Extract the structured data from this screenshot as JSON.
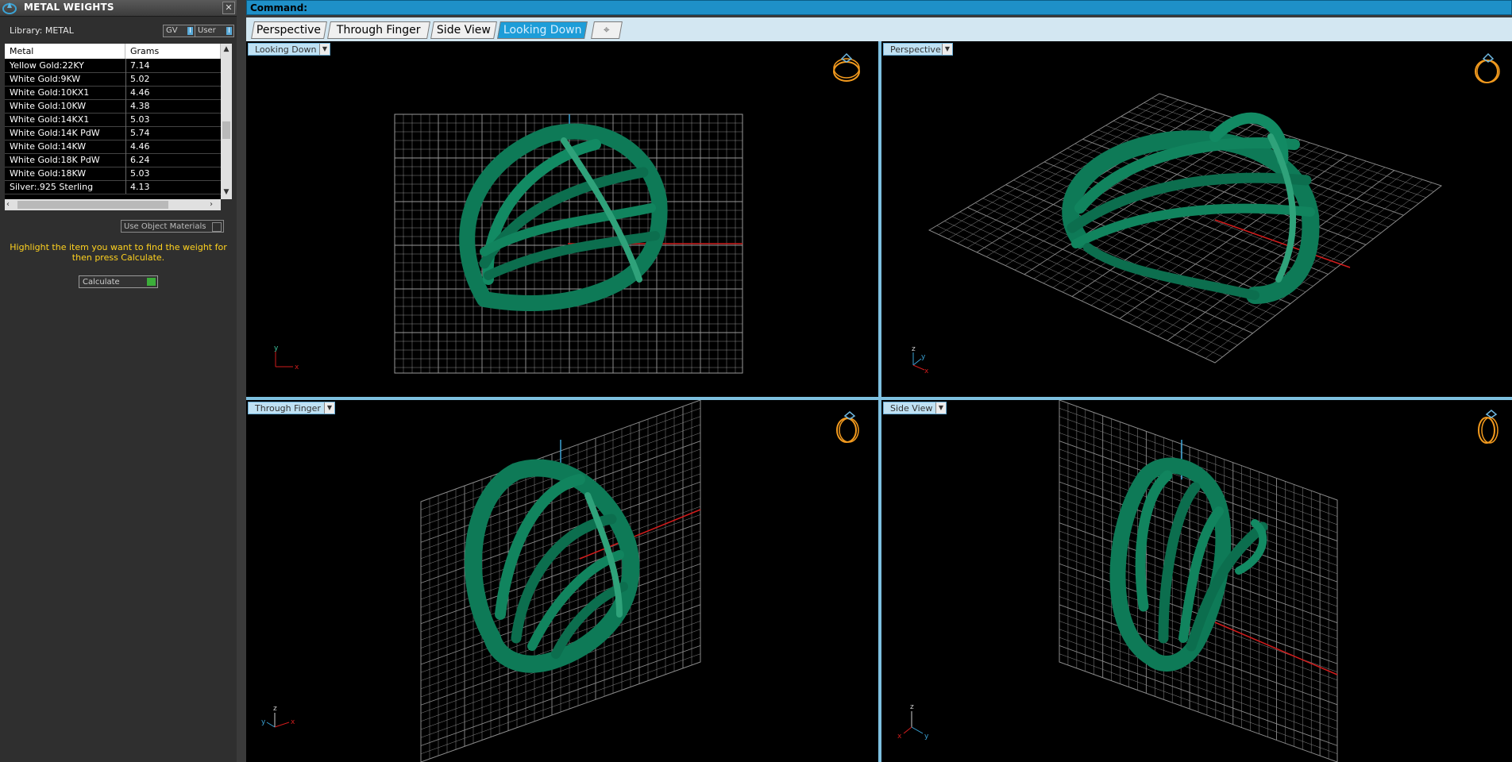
{
  "panel": {
    "title": "METAL WEIGHTS",
    "close": "✕",
    "library_label": "Library: METAL",
    "toggles": [
      {
        "label": "GV",
        "state": "I"
      },
      {
        "label": "User",
        "state": "I"
      }
    ],
    "table": {
      "columns": [
        "Metal",
        "Grams"
      ],
      "rows": [
        {
          "metal": "Yellow Gold:22KY",
          "grams": "7.14"
        },
        {
          "metal": "White Gold:9KW",
          "grams": "5.02"
        },
        {
          "metal": "White Gold:10KX1",
          "grams": "4.46"
        },
        {
          "metal": "White Gold:10KW",
          "grams": "4.38"
        },
        {
          "metal": "White Gold:14KX1",
          "grams": "5.03"
        },
        {
          "metal": "White Gold:14K PdW",
          "grams": "5.74"
        },
        {
          "metal": "White Gold:14KW",
          "grams": "4.46"
        },
        {
          "metal": "White Gold:18K PdW",
          "grams": "6.24"
        },
        {
          "metal": "White Gold:18KW",
          "grams": "5.03"
        },
        {
          "metal": "Silver:.925 Sterling",
          "grams": "4.13"
        }
      ]
    },
    "use_object_materials": "Use Object Materials",
    "instruction": "Highlight the item you want to find the weight for then press Calculate.",
    "calculate": "Calculate"
  },
  "command": {
    "label": "Command:"
  },
  "tabs": [
    {
      "label": "Perspective",
      "active": false
    },
    {
      "label": "Through Finger",
      "active": false
    },
    {
      "label": "Side View",
      "active": false
    },
    {
      "label": "Looking Down",
      "active": true
    },
    {
      "label": "⌖",
      "active": false
    }
  ],
  "viewports": [
    {
      "label": "Looking Down",
      "axes": [
        "y",
        "x"
      ]
    },
    {
      "label": "Perspective",
      "axes": [
        "z",
        "y",
        "x"
      ]
    },
    {
      "label": "Through Finger",
      "axes": [
        "z",
        "y",
        "x"
      ]
    },
    {
      "label": "Side View",
      "axes": [
        "z",
        "x",
        "y"
      ]
    }
  ],
  "colors": {
    "ring_green": "#0e7a57",
    "grid_line": "#9a9a9a",
    "axis_red": "#d01c1c",
    "axis_blue": "#3aa3d6",
    "accent_tab": "#1d9dd8",
    "instruction_yellow": "#ffd21f"
  }
}
